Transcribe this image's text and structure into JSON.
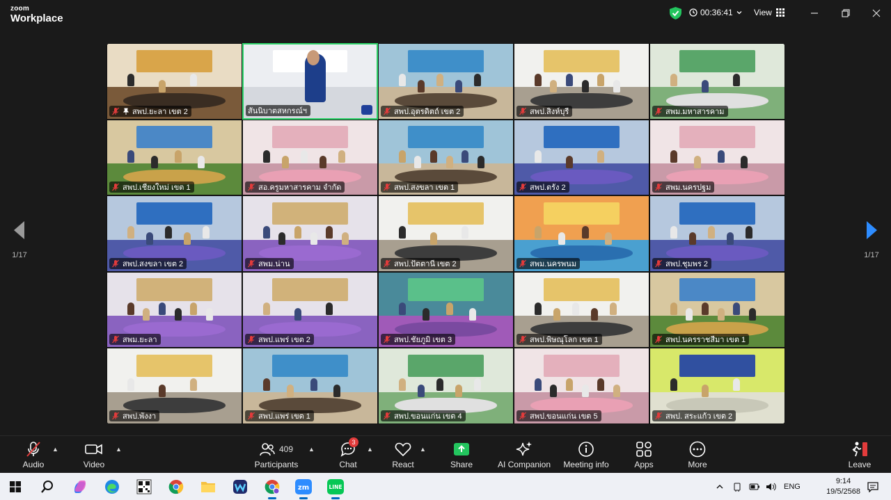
{
  "app": {
    "logo_line1": "zoom",
    "logo_line2": "Workplace",
    "timer": "00:36:41",
    "view_label": "View"
  },
  "colors": {
    "active_speaker": "#2ed66b",
    "mic_muted": "#e23b3b",
    "share_green": "#23c55e",
    "side_arrow_active": "#2d8cff"
  },
  "pagination": {
    "left": "1/17",
    "right": "1/17"
  },
  "participants": [
    {
      "name": "สพป.ยะลา เขต 2",
      "muted": true,
      "pinned": true,
      "theme": "hall"
    },
    {
      "name": "สันนิบาตสหกรณ์ฯ",
      "muted": false,
      "active": true,
      "theme": "speaker"
    },
    {
      "name": "สพป.อุตรดิตถ์ เขต 2",
      "muted": true,
      "theme": "meeting"
    },
    {
      "name": "สพป.สิงห์บุรี",
      "muted": true,
      "theme": "white"
    },
    {
      "name": "สพม.มหาสารคาม",
      "muted": true,
      "theme": "green"
    },
    {
      "name": "สพป.เชียงใหม่ เขต 1",
      "muted": true,
      "theme": "gold"
    },
    {
      "name": "สอ.ครูมหาสารคาม จำกัด",
      "muted": true,
      "theme": "pink"
    },
    {
      "name": "สพป.สงขลา เขต 1",
      "muted": true,
      "theme": "meeting"
    },
    {
      "name": "สพป.ตรัง 2",
      "muted": true,
      "theme": "blue"
    },
    {
      "name": "สพม.นครปฐม",
      "muted": true,
      "theme": "pink"
    },
    {
      "name": "สพป.สงขลา เขต 2",
      "muted": true,
      "theme": "blue"
    },
    {
      "name": "สพม.น่าน",
      "muted": true,
      "theme": "purple"
    },
    {
      "name": "สพป.ปัตตานี เขต 2",
      "muted": true,
      "theme": "white"
    },
    {
      "name": "สพม.นครพนม",
      "muted": true,
      "theme": "sunset"
    },
    {
      "name": "สพป.ชุมพร 2",
      "muted": true,
      "theme": "blue"
    },
    {
      "name": "สพม.ยะลา",
      "muted": true,
      "theme": "purple"
    },
    {
      "name": "สพป.แพร่ เขต 2",
      "muted": true,
      "theme": "purple"
    },
    {
      "name": "สพป.ชัยภูมิ เขต 3",
      "muted": true,
      "theme": "flowers"
    },
    {
      "name": "สพป.พิษณุโลก เขต 1",
      "muted": true,
      "theme": "white"
    },
    {
      "name": "สพป.นครราชสีมา เขต 1",
      "muted": true,
      "theme": "gold"
    },
    {
      "name": "สพป.พังงา",
      "muted": true,
      "theme": "white"
    },
    {
      "name": "สพป.แพร่ เขต 1",
      "muted": true,
      "theme": "meeting"
    },
    {
      "name": "สพป.ขอนแก่น เขต 4",
      "muted": true,
      "theme": "green"
    },
    {
      "name": "สพป.ขอนแก่น เขต 5",
      "muted": true,
      "theme": "pink"
    },
    {
      "name": "สพป. สระแก้ว เขต 2",
      "muted": true,
      "theme": "lime"
    }
  ],
  "toolbar": {
    "audio": "Audio",
    "video": "Video",
    "participants": "Participants",
    "participants_count": "409",
    "chat": "Chat",
    "chat_badge": "3",
    "react": "React",
    "share": "Share",
    "ai_companion": "AI Companion",
    "meeting_info": "Meeting info",
    "apps": "Apps",
    "more": "More",
    "leave": "Leave"
  },
  "taskbar": {
    "language": "ENG",
    "time": "9:14",
    "date": "19/5/2568",
    "apps": [
      "start-icon",
      "search-icon",
      "copilot-icon",
      "edge-icon",
      "qr-app-icon",
      "chrome-icon",
      "file-explorer-icon",
      "webex-icon",
      "chrome-profile-icon",
      "zoom-icon",
      "line-icon"
    ]
  }
}
